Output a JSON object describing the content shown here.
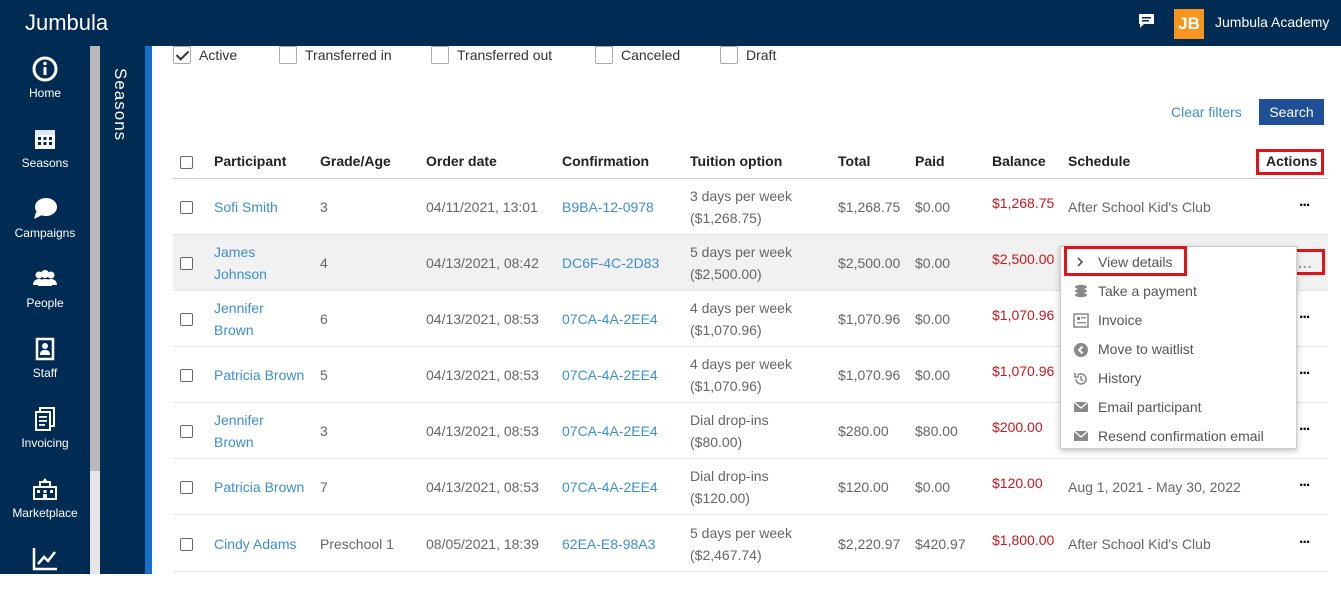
{
  "app": {
    "title": "Jumbula",
    "org_name": "Jumbula Academy",
    "org_logo": "JB"
  },
  "sidebar": {
    "items": [
      {
        "label": "Home",
        "icon": "home-icon"
      },
      {
        "label": "Seasons",
        "icon": "calendar-icon"
      },
      {
        "label": "Campaigns",
        "icon": "speech-bubble-icon"
      },
      {
        "label": "People",
        "icon": "people-icon"
      },
      {
        "label": "Staff",
        "icon": "staff-icon"
      },
      {
        "label": "Invoicing",
        "icon": "invoice-icon"
      },
      {
        "label": "Marketplace",
        "icon": "marketplace-icon"
      },
      {
        "label": "",
        "icon": "chart-icon"
      }
    ],
    "section_label": "Seasons"
  },
  "filters": {
    "statuses": [
      {
        "label": "Active",
        "checked": true
      },
      {
        "label": "Transferred in",
        "checked": false
      },
      {
        "label": "Transferred out",
        "checked": false
      },
      {
        "label": "Canceled",
        "checked": false
      },
      {
        "label": "Draft",
        "checked": false
      }
    ],
    "clear_label": "Clear filters",
    "search_label": "Search"
  },
  "table": {
    "headers": {
      "participant": "Participant",
      "grade": "Grade/Age",
      "order_date": "Order date",
      "confirmation": "Confirmation",
      "tuition": "Tuition option",
      "total": "Total",
      "paid": "Paid",
      "balance": "Balance",
      "schedule": "Schedule",
      "actions": "Actions"
    },
    "rows": [
      {
        "participant": [
          "Sofi Smith"
        ],
        "grade": "3",
        "order_date": "04/11/2021, 13:01",
        "confirmation": "B9BA-12-0978",
        "tuition": [
          "3 days per week",
          "($1,268.75)"
        ],
        "total": "$1,268.75",
        "paid": "$0.00",
        "balance": "$1,268.75",
        "schedule": "After School Kid's Club"
      },
      {
        "participant": [
          "James",
          "Johnson"
        ],
        "grade": "4",
        "order_date": "04/13/2021, 08:42",
        "confirmation": "DC6F-4C-2D83",
        "tuition": [
          "5 days per week",
          "($2,500.00)"
        ],
        "total": "$2,500.00",
        "paid": "$0.00",
        "balance": "$2,500.00",
        "schedule": ""
      },
      {
        "participant": [
          "Jennifer",
          "Brown"
        ],
        "grade": "6",
        "order_date": "04/13/2021, 08:53",
        "confirmation": "07CA-4A-2EE4",
        "tuition": [
          "4 days per week",
          "($1,070.96)"
        ],
        "total": "$1,070.96",
        "paid": "$0.00",
        "balance": "$1,070.96",
        "schedule": ""
      },
      {
        "participant": [
          "Patricia Brown"
        ],
        "grade": "5",
        "order_date": "04/13/2021, 08:53",
        "confirmation": "07CA-4A-2EE4",
        "tuition": [
          "4 days per week",
          "($1,070.96)"
        ],
        "total": "$1,070.96",
        "paid": "$0.00",
        "balance": "$1,070.96",
        "schedule": ""
      },
      {
        "participant": [
          "Jennifer",
          "Brown"
        ],
        "grade": "3",
        "order_date": "04/13/2021, 08:53",
        "confirmation": "07CA-4A-2EE4",
        "tuition": [
          "Dial drop-ins",
          "($80.00)"
        ],
        "total": "$280.00",
        "paid": "$80.00",
        "balance": "$200.00",
        "schedule": ""
      },
      {
        "participant": [
          "Patricia Brown"
        ],
        "grade": "7",
        "order_date": "04/13/2021, 08:53",
        "confirmation": "07CA-4A-2EE4",
        "tuition": [
          "Dial drop-ins",
          "($120.00)"
        ],
        "total": "$120.00",
        "paid": "$0.00",
        "balance": "$120.00",
        "schedule": "Aug 1, 2021 - May 30, 2022"
      },
      {
        "participant": [
          "Cindy Adams"
        ],
        "grade": "Preschool 1",
        "order_date": "08/05/2021, 18:39",
        "confirmation": "62EA-E8-98A3",
        "tuition": [
          "5 days per week",
          "($2,467.74)"
        ],
        "total": "$2,220.97",
        "paid": "$420.97",
        "balance": "$1,800.00",
        "schedule": "After School Kid's Club"
      }
    ]
  },
  "actions_menu": {
    "trigger": "...",
    "items": [
      {
        "label": "View details",
        "icon": "chevron-right-icon"
      },
      {
        "label": "Take a payment",
        "icon": "coins-icon"
      },
      {
        "label": "Invoice",
        "icon": "invoice-icon"
      },
      {
        "label": "Move to waitlist",
        "icon": "arrow-left-circle-icon"
      },
      {
        "label": "History",
        "icon": "history-icon"
      },
      {
        "label": "Email participant",
        "icon": "envelope-icon"
      },
      {
        "label": "Resend confirmation email",
        "icon": "envelope-icon"
      }
    ]
  }
}
